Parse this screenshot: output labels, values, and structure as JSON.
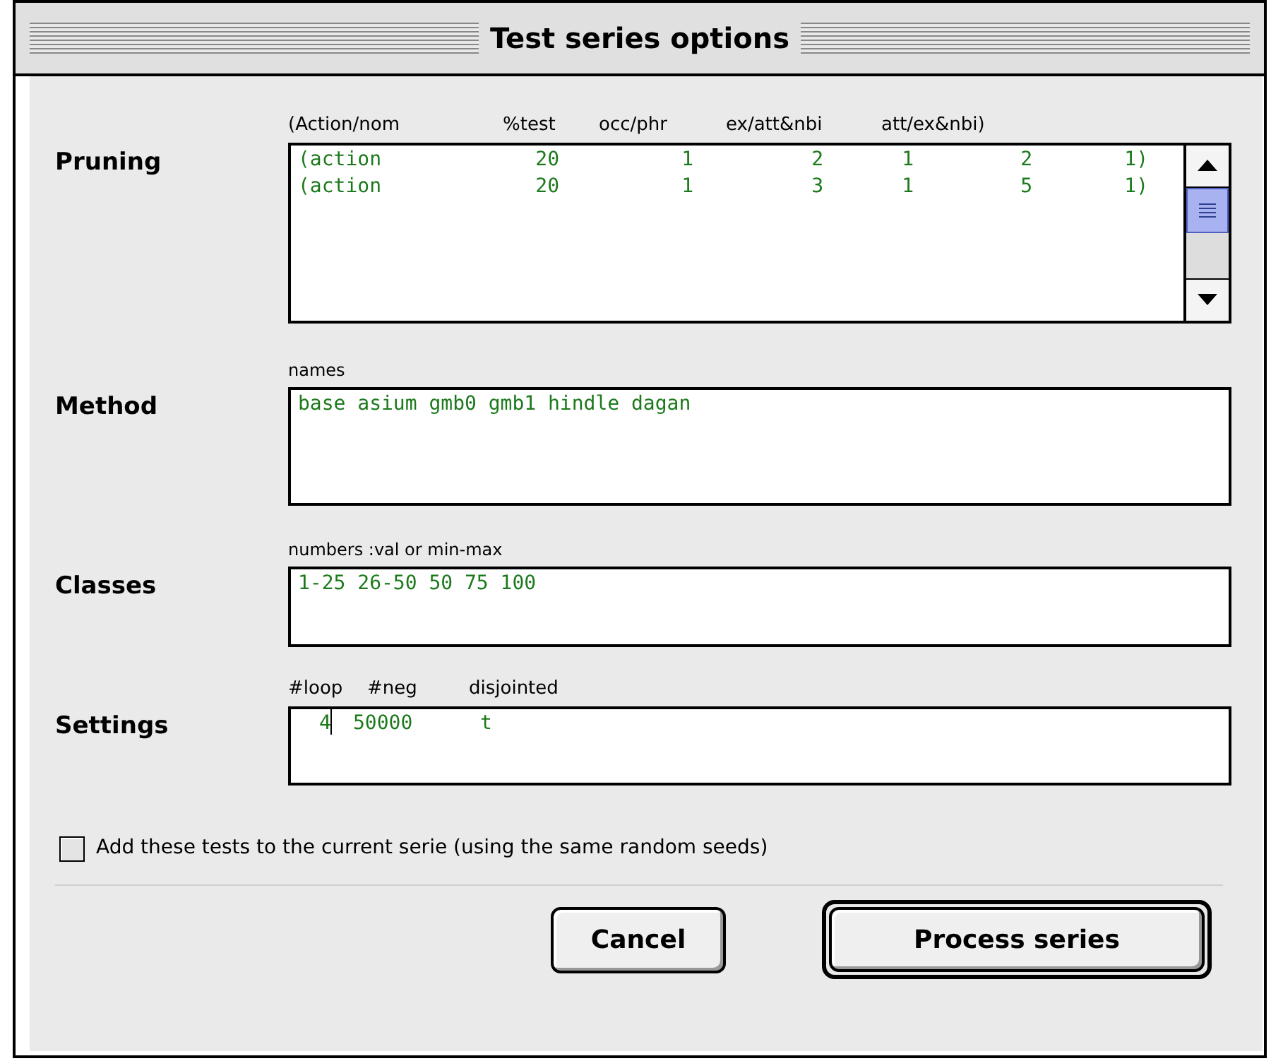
{
  "window": {
    "title": "Test series options"
  },
  "pruning": {
    "label": "Pruning",
    "columns": [
      "(Action/nom",
      "%test",
      "occ/phr",
      "ex/att&nbi",
      "att/ex&nbi)"
    ],
    "rows": [
      [
        "(action",
        "20",
        "1",
        "2",
        "1",
        "2",
        "1)"
      ],
      [
        "(action",
        "20",
        "1",
        "3",
        "1",
        "5",
        "1)"
      ]
    ]
  },
  "method": {
    "label": "Method",
    "hint": "names",
    "value": "base asium gmb0 gmb1 hindle dagan"
  },
  "classes": {
    "label": "Classes",
    "hint": "numbers :val or min-max",
    "value": "1-25 26-50 50 75 100"
  },
  "settings": {
    "label": "Settings",
    "columns": [
      "#loop",
      "#neg",
      "disjointed"
    ],
    "values": [
      "4",
      "50000",
      "t"
    ],
    "focused": true
  },
  "option": {
    "label": "Add these tests to the current serie (using the same random seeds)",
    "checked": false
  },
  "buttons": [
    {
      "label": "Cancel",
      "default": false
    },
    {
      "label": "Process series",
      "default": true
    }
  ]
}
